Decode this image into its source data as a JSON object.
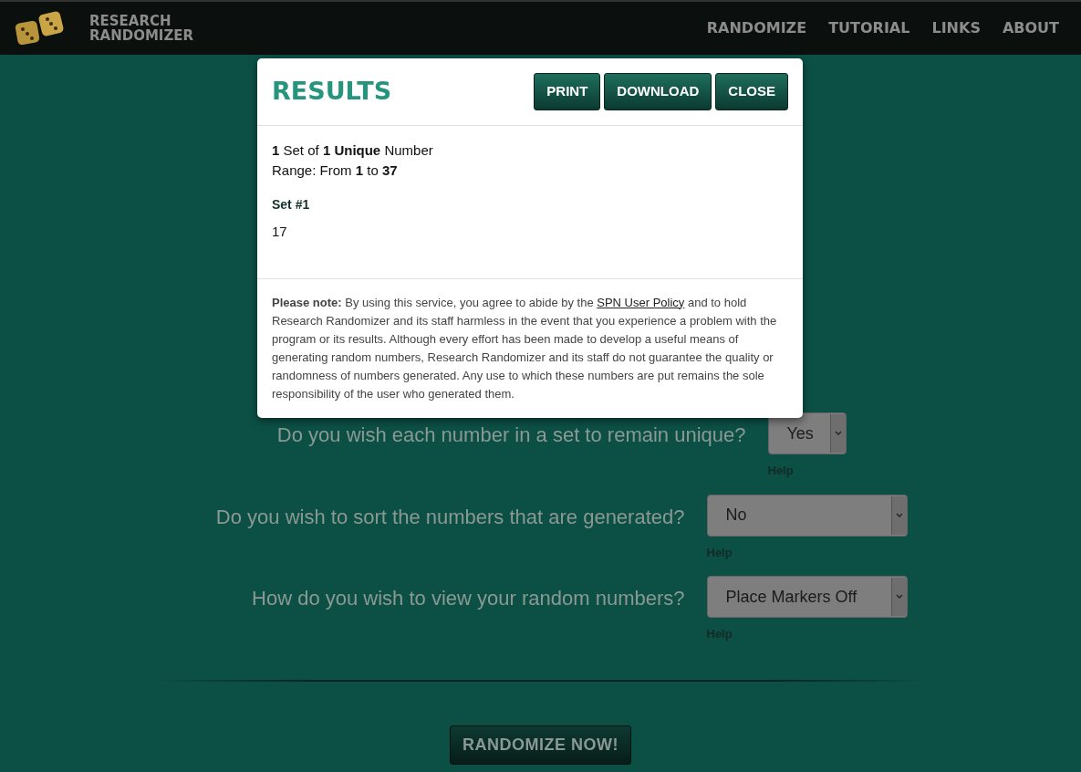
{
  "brand": {
    "lines": [
      "RESEARCH",
      "RANDOMIZER"
    ]
  },
  "nav": [
    "RANDOMIZE",
    "TUTORIAL",
    "LINKS",
    "ABOUT"
  ],
  "form": {
    "questions": [
      {
        "label": "Do you wish each number in a set to remain unique?",
        "value": "Yes",
        "help": "Help"
      },
      {
        "label": "Do you wish to sort the numbers that are generated?",
        "value": "No",
        "help": "Help"
      },
      {
        "label": "How do you wish to view your random numbers?",
        "value": "Place Markers Off",
        "help": "Help"
      }
    ],
    "submit": "RANDOMIZE NOW!"
  },
  "modal": {
    "title": "RESULTS",
    "buttons": [
      "PRINT",
      "DOWNLOAD",
      "CLOSE"
    ],
    "summary": [
      "**1** Set of **1 Unique** Number",
      "Range: From **1** to **37**"
    ],
    "sets": [
      {
        "title": "Set #1",
        "numbers": "17"
      }
    ],
    "note": {
      "before": "**Please note:** By using this service, you agree to abide by the",
      "link": "SPN User Policy",
      "after": "and to hold Research Randomizer and its staff harmless in the event that you experience a problem with the program or its results. Although every effort has been made to develop a useful means of generating random numbers, Research Randomizer and its staff do not guarantee the quality or randomness of numbers generated. Any use to which these numbers are put remains the sole responsibility of the user who generated them."
    }
  }
}
